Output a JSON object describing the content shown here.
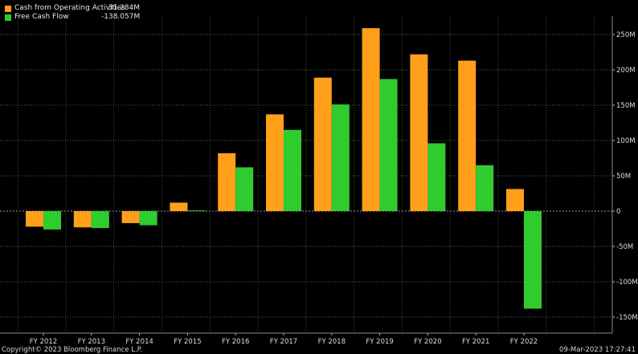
{
  "chart_data": {
    "type": "bar",
    "categories": [
      "FY 2012",
      "FY 2013",
      "FY 2014",
      "FY 2015",
      "FY 2016",
      "FY 2017",
      "FY 2018",
      "FY 2019",
      "FY 2020",
      "FY 2021",
      "FY 2022"
    ],
    "series": [
      {
        "name": "Cash from Operating Activities",
        "latest_label": "31.284M",
        "color": "#ff9f1a",
        "values": [
          -22,
          -23,
          -17,
          12,
          82,
          137,
          189,
          259,
          222,
          213,
          31.284
        ]
      },
      {
        "name": "Free Cash Flow",
        "latest_label": "-138.057M",
        "color": "#2fcc2f",
        "values": [
          -26,
          -24,
          -20,
          1,
          62,
          115,
          151,
          187,
          96,
          65,
          -138.057
        ]
      }
    ],
    "ylim": [
      -160,
      270
    ],
    "yticks": [
      -150,
      -100,
      -50,
      0,
      50,
      100,
      150,
      200,
      250
    ],
    "ytick_labels": [
      "-150M",
      "-100M",
      "-50M",
      "0",
      "50M",
      "100M",
      "150M",
      "200M",
      "250M"
    ],
    "grid": true,
    "legend_position": "top-left"
  },
  "footer": {
    "copyright": "Copyright© 2023 Bloomberg Finance L.P.",
    "timestamp": "09-Mar-2023 17:27:41"
  }
}
